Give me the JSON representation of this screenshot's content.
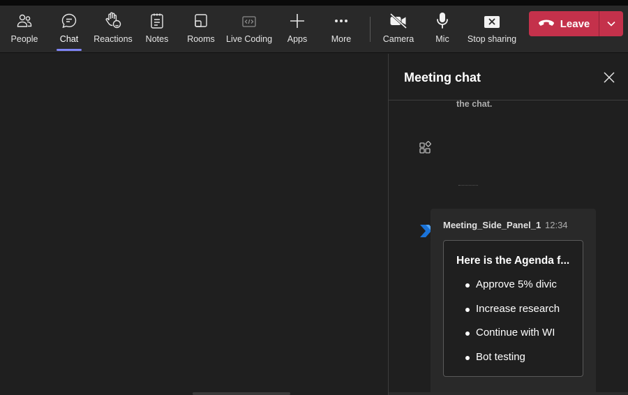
{
  "toolbar": {
    "people": "People",
    "chat": "Chat",
    "reactions": "Reactions",
    "notes": "Notes",
    "rooms": "Rooms",
    "live_coding": "Live Coding",
    "apps": "Apps",
    "more": "More",
    "camera": "Camera",
    "mic": "Mic",
    "stop_sharing": "Stop sharing",
    "leave": "Leave",
    "active_tab": "Chat"
  },
  "colors": {
    "accent": "#7f85f5",
    "leave": "#c4314b",
    "presence": "#6bb700"
  },
  "chat_panel": {
    "title": "Meeting chat",
    "system_text_fragment": "the chat.",
    "message": {
      "sender": "Meeting_Side_Panel_1",
      "time": "12:34",
      "card_title": "Here is the Agenda f...",
      "agenda_items": [
        "Approve 5% divic",
        "Increase research",
        "Continue with WI",
        "Bot testing"
      ]
    }
  },
  "icons": {
    "people": "people-icon",
    "chat": "chat-icon",
    "reactions": "hand-icon",
    "notes": "notes-icon",
    "rooms": "rooms-icon",
    "live_coding": "live-coding-icon",
    "apps": "plus-icon",
    "more": "more-icon",
    "camera": "camera-off-icon",
    "mic": "mic-icon",
    "stop_sharing": "stop-share-icon",
    "leave": "phone-hangup-icon",
    "close": "close-icon",
    "apps_panel": "apps-add-icon",
    "bot": "bot-avatar-icon"
  }
}
